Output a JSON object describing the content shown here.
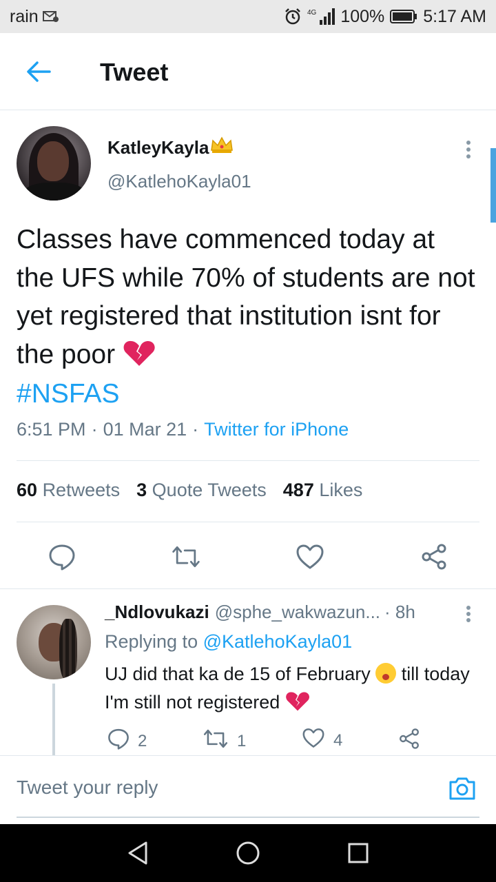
{
  "status_bar": {
    "carrier": "rain",
    "network": "4G",
    "battery": "100%",
    "time": "5:17 AM"
  },
  "header": {
    "title": "Tweet"
  },
  "tweet": {
    "display_name": "KatleyKayla",
    "handle": "@KatlehoKayla01",
    "text": "Classes have commenced today at the UFS while 70% of students are not yet registered that institution isnt for the poor",
    "hashtag": "#NSFAS",
    "time": "6:51 PM",
    "date": "01 Mar 21",
    "source": "Twitter for iPhone",
    "retweets_count": "60",
    "retweets_label": "Retweets",
    "quotes_count": "3",
    "quotes_label": "Quote Tweets",
    "likes_count": "487",
    "likes_label": "Likes"
  },
  "reply": {
    "display_name": "_Ndlovukazi",
    "handle": "@sphe_wakwazun...",
    "time": "· 8h",
    "replying_prefix": "Replying to",
    "replying_handle": "@KatlehoKayla01",
    "text_part1": "UJ did that ka de 15 of February",
    "text_part2": "till today I'm still not registered",
    "reply_count": "2",
    "retweet_count": "1",
    "like_count": "4"
  },
  "composer": {
    "placeholder": "Tweet your reply"
  },
  "colors": {
    "accent": "#1da1f2",
    "secondary_text": "#657786",
    "heart": "#e0245e"
  }
}
